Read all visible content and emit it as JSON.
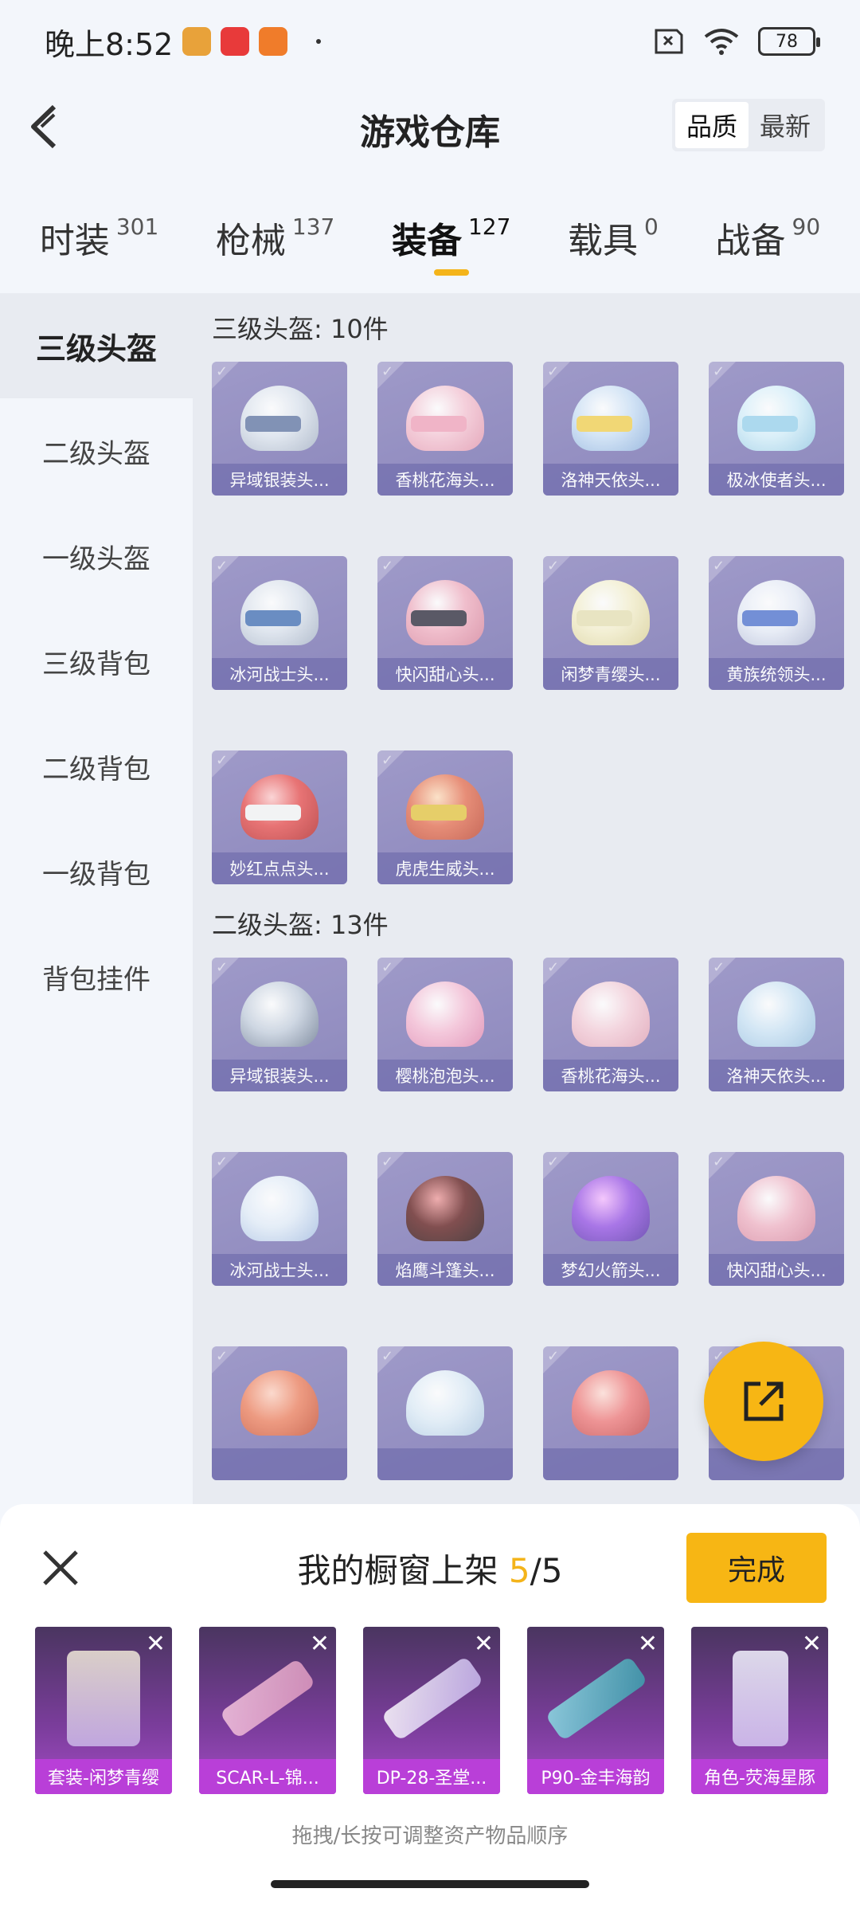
{
  "status": {
    "time": "晚上8:52",
    "battery": "78"
  },
  "header": {
    "title": "游戏仓库",
    "sort_quality": "品质",
    "sort_latest": "最新"
  },
  "tabs": [
    {
      "label": "时装",
      "count": "301"
    },
    {
      "label": "枪械",
      "count": "137"
    },
    {
      "label": "装备",
      "count": "127"
    },
    {
      "label": "载具",
      "count": "0"
    },
    {
      "label": "战备",
      "count": "90"
    }
  ],
  "sidebar": [
    "三级头盔",
    "二级头盔",
    "一级头盔",
    "三级背包",
    "二级背包",
    "一级背包",
    "背包挂件"
  ],
  "sections": [
    {
      "title": "三级头盔: 10件",
      "items": [
        "异域银装头...",
        "香桃花海头...",
        "洛神天依头...",
        "极冰使者头...",
        "冰河战士头...",
        "快闪甜心头...",
        "闲梦青缨头...",
        "黄族统领头...",
        "妙红点点头...",
        "虎虎生威头..."
      ]
    },
    {
      "title": "二级头盔: 13件",
      "items": [
        "异域银装头...",
        "樱桃泡泡头...",
        "香桃花海头...",
        "洛神天依头...",
        "冰河战士头...",
        "焰鹰斗篷头...",
        "梦幻火箭头...",
        "快闪甜心头...",
        "",
        "",
        "",
        ""
      ]
    }
  ],
  "sheet": {
    "title_prefix": "我的橱窗上架 ",
    "count": "5",
    "total": "/5",
    "done_label": "完成",
    "hint": "拖拽/长按可调整资产物品顺序",
    "items": [
      "套装-闲梦青缨",
      "SCAR-L-锦...",
      "DP-28-圣堂...",
      "P90-金丰海韵",
      "角色-荧海星豚"
    ]
  },
  "colors": {
    "accent": "#f7b614",
    "item_bg": "#8f88c0",
    "showcase_bg": "#b93fd8"
  }
}
